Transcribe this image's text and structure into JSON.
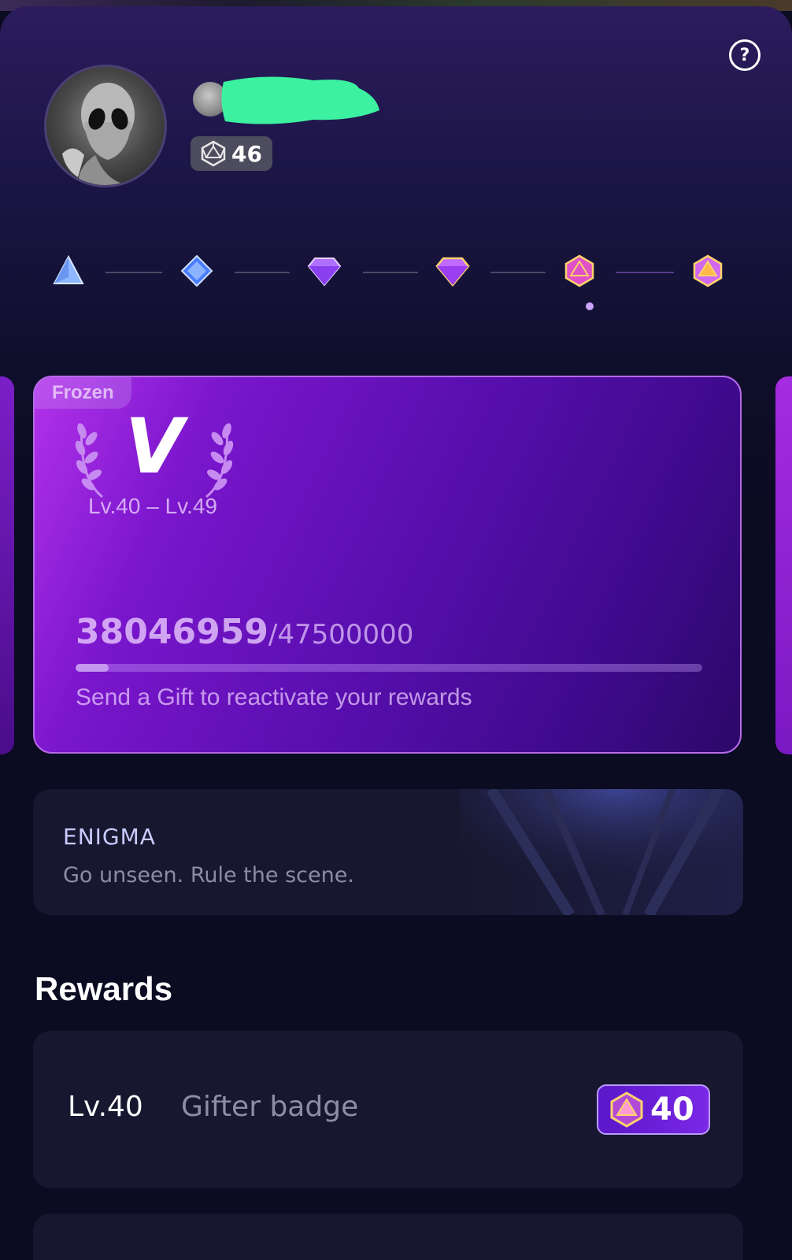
{
  "profile": {
    "level": "46",
    "avatar_icon": "alien-avatar-icon",
    "name_redacted": true
  },
  "header": {
    "help_label": "?"
  },
  "tiers": {
    "icons": [
      "tier-1-gem-icon",
      "tier-2-gem-icon",
      "tier-3-gem-icon",
      "tier-4-gem-icon",
      "tier-5-gem-icon",
      "tier-6-gem-icon"
    ],
    "selected_index": 4
  },
  "level_card": {
    "status": "Frozen",
    "tier_letter": "V",
    "level_range": "Lv.40 – Lv.49",
    "current_points": "38046959",
    "total_points": "/47500000",
    "progress_fraction": 0.053,
    "note": "Send a Gift to reactivate your rewards"
  },
  "enigma": {
    "title": "ENIGMA",
    "subtitle": "Go unseen. Rule the scene."
  },
  "rewards": {
    "title": "Rewards",
    "items": [
      {
        "level": "Lv.40",
        "name": "Gifter badge",
        "badge_value": "40"
      }
    ]
  },
  "colors": {
    "accent": "#7a16cc",
    "card_gradient_start": "#b232ea",
    "background": "#0b0b22",
    "redaction": "#3cf2a0"
  }
}
